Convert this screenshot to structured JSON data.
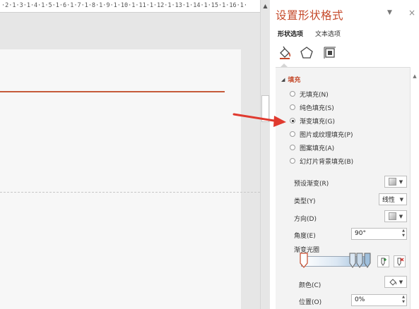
{
  "ruler": {
    "text": "·2·1·3·1·4·1·5·1·6·1·7·1·8·1·9·1·10·1·11·1·12·1·13·1·14·1·15·1·16·1·"
  },
  "pane": {
    "title": "设置形状格式",
    "tabs": {
      "shape_options": "形状选项",
      "text_options": "文本选项"
    },
    "categories": {
      "fill_line": "fill-line-icon",
      "effects": "pentagon-icon",
      "size_properties": "size-properties-icon"
    },
    "fill_section": {
      "title": "填充",
      "options": [
        {
          "label": "无填充(N)",
          "checked": false
        },
        {
          "label": "纯色填充(S)",
          "checked": false
        },
        {
          "label": "渐变填充(G)",
          "checked": true
        },
        {
          "label": "图片或纹理填充(P)",
          "checked": false
        },
        {
          "label": "图案填充(A)",
          "checked": false
        },
        {
          "label": "幻灯片背景填充(B)",
          "checked": false
        }
      ],
      "preset_gradient_label": "预设渐变(R)",
      "type_label": "类型(Y)",
      "type_value": "线性",
      "direction_label": "方向(D)",
      "angle_label": "角度(E)",
      "angle_value": "90°",
      "gradient_stops_label": "渐变光圈",
      "color_label": "颜色(C)",
      "position_label": "位置(O)",
      "position_value": "0%"
    }
  },
  "colors": {
    "accent": "#c5492a",
    "slide_line": "#c55a3a",
    "arrow": "#e03a2f"
  }
}
